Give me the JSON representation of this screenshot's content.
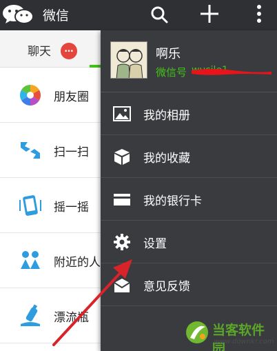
{
  "app": {
    "title": "微信"
  },
  "tabs": {
    "chat_label": "聊天",
    "chat_badge": "…"
  },
  "discover": {
    "items": [
      {
        "label": "朋友圈",
        "icon": "moments-icon"
      },
      {
        "label": "扫一扫",
        "icon": "scan-icon"
      },
      {
        "label": "摇一摇",
        "icon": "shake-icon"
      },
      {
        "label": "附近的人",
        "icon": "people-nearby-icon"
      },
      {
        "label": "漂流瓶",
        "icon": "drift-bottle-icon"
      }
    ]
  },
  "menu": {
    "profile": {
      "name": "啊乐",
      "wechat_id_label": "微信号",
      "wechat_id_value": "wusile1"
    },
    "items": [
      {
        "label": "我的相册",
        "icon": "album-icon"
      },
      {
        "label": "我的收藏",
        "icon": "favorites-icon"
      },
      {
        "label": "我的银行卡",
        "icon": "bank-card-icon"
      },
      {
        "label": "设置",
        "icon": "gear-icon"
      },
      {
        "label": "意见反馈",
        "icon": "feedback-icon"
      }
    ]
  },
  "watermark": {
    "title": "当客软件园",
    "url": "www.downkr.com"
  },
  "colors": {
    "appbar": "#2e3034",
    "menu": "#3a3b3f",
    "accent_green": "#45c01a",
    "badge_red": "#e4453c",
    "arrow_red": "#d8232a"
  }
}
